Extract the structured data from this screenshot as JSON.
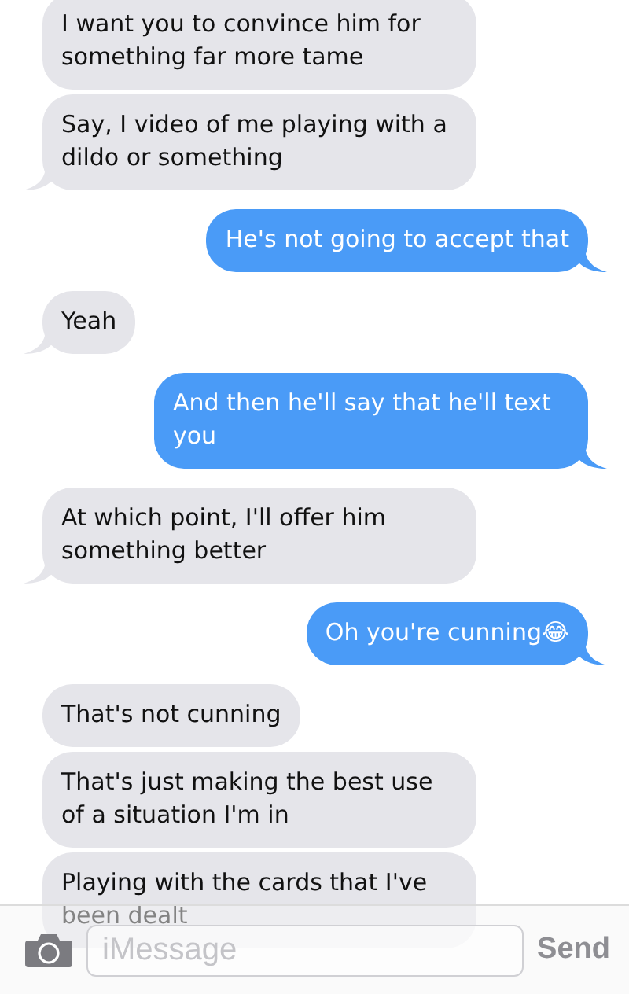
{
  "messages": [
    {
      "text": "I want you to convince him for something far more tame",
      "kind": "received",
      "tail": false
    },
    {
      "text": "Say, I video of me playing with a dildo or something",
      "kind": "received",
      "tail": true
    },
    {
      "text": "He's not going to accept that",
      "kind": "sent",
      "tail": true
    },
    {
      "text": "Yeah",
      "kind": "received",
      "tail": true
    },
    {
      "text": "And then he'll say that he'll text you",
      "kind": "sent",
      "tail": true
    },
    {
      "text": "At which point, I'll offer him something better",
      "kind": "received",
      "tail": true
    },
    {
      "text": "Oh you're cunning😂",
      "kind": "sent",
      "tail": true
    },
    {
      "text": "That's not cunning",
      "kind": "received",
      "tail": false
    },
    {
      "text": "That's just making the best use of a situation I'm in",
      "kind": "received",
      "tail": false
    },
    {
      "text": "Playing with the cards that I've been dealt",
      "kind": "received",
      "tail": false
    }
  ],
  "composer": {
    "placeholder": "iMessage",
    "send": "Send"
  }
}
